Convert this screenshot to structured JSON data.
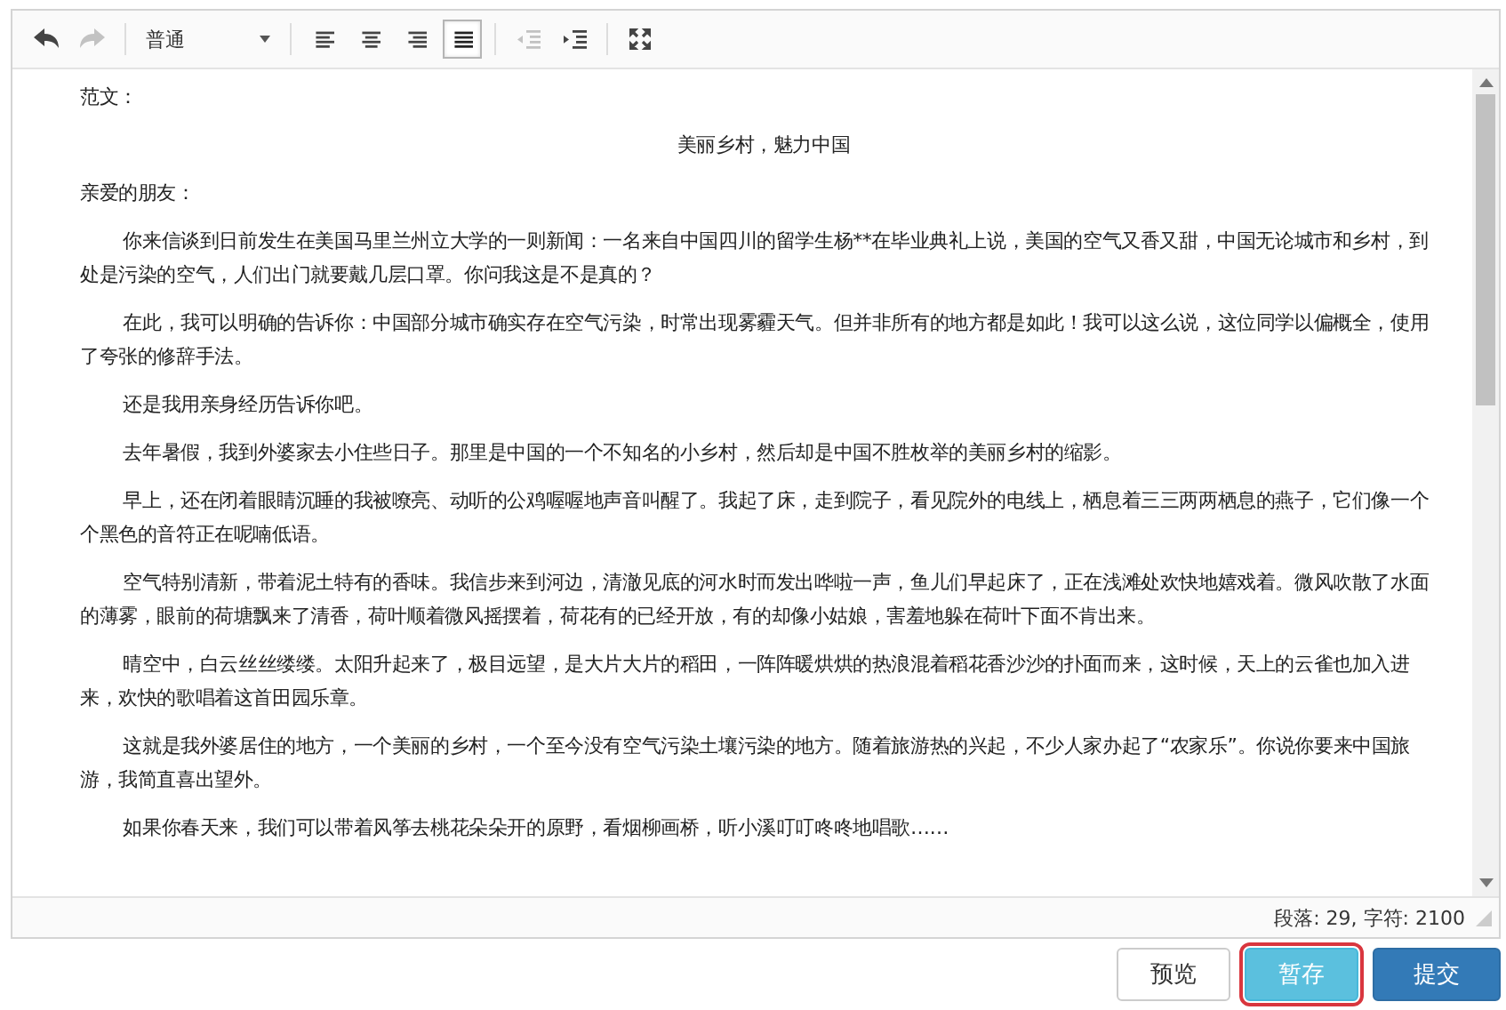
{
  "toolbar": {
    "groups": [
      {
        "tools": [
          {
            "kind": "undo",
            "disabled": false,
            "selected": false
          },
          {
            "kind": "redo",
            "disabled": true,
            "selected": false
          }
        ]
      },
      {
        "tools": [
          {
            "kind": "select",
            "value": "普通"
          }
        ]
      },
      {
        "tools": [
          {
            "kind": "align-left",
            "disabled": false,
            "selected": false
          },
          {
            "kind": "align-center",
            "disabled": false,
            "selected": false
          },
          {
            "kind": "align-right",
            "disabled": false,
            "selected": false
          },
          {
            "kind": "align-justify",
            "disabled": false,
            "selected": true
          }
        ]
      },
      {
        "tools": [
          {
            "kind": "outdent",
            "disabled": true,
            "selected": false
          },
          {
            "kind": "indent",
            "disabled": false,
            "selected": false
          }
        ]
      },
      {
        "tools": [
          {
            "kind": "fullscreen",
            "disabled": false,
            "selected": false
          }
        ]
      }
    ]
  },
  "content": {
    "paragraphs": [
      {
        "kind": "plain",
        "text": "范文："
      },
      {
        "kind": "center",
        "text": "美丽乡村，魅力中国"
      },
      {
        "kind": "plain",
        "text": "亲爱的朋友："
      },
      {
        "kind": "indent",
        "text": "你来信谈到日前发生在美国马里兰州立大学的一则新闻：一名来自中国四川的留学生杨**在毕业典礼上说，美国的空气又香又甜，中国无论城市和乡村，到处是污染的空气，人们出门就要戴几层口罩。你问我这是不是真的？"
      },
      {
        "kind": "indent",
        "text": "在此，我可以明确的告诉你：中国部分城市确实存在空气污染，时常出现雾霾天气。但并非所有的地方都是如此！我可以这么说，这位同学以偏概全，使用了夸张的修辞手法。"
      },
      {
        "kind": "indent",
        "text": "还是我用亲身经历告诉你吧。"
      },
      {
        "kind": "indent",
        "text": "去年暑假，我到外婆家去小住些日子。那里是中国的一个不知名的小乡村，然后却是中国不胜枚举的美丽乡村的缩影。"
      },
      {
        "kind": "indent",
        "text": "早上，还在闭着眼睛沉睡的我被嘹亮、动听的公鸡喔喔地声音叫醒了。我起了床，走到院子，看见院外的电线上，栖息着三三两两栖息的燕子，它们像一个个黑色的音符正在呢喃低语。"
      },
      {
        "kind": "indent",
        "text": "空气特别清新，带着泥土特有的香味。我信步来到河边，清澈见底的河水时而发出哗啦一声，鱼儿们早起床了，正在浅滩处欢快地嬉戏着。微风吹散了水面的薄雾，眼前的荷塘飘来了清香，荷叶顺着微风摇摆着，荷花有的已经开放，有的却像小姑娘，害羞地躲在荷叶下面不肯出来。"
      },
      {
        "kind": "indent",
        "text": "晴空中，白云丝丝缕缕。太阳升起来了，极目远望，是大片大片的稻田，一阵阵暖烘烘的热浪混着稻花香沙沙的扑面而来，这时候，天上的云雀也加入进来，欢快的歌唱着这首田园乐章。"
      },
      {
        "kind": "indent",
        "text": "这就是我外婆居住的地方，一个美丽的乡村，一个至今没有空气污染土壤污染的地方。随着旅游热的兴起，不少人家办起了“农家乐”。你说你要来中国旅游，我简直喜出望外。"
      },
      {
        "kind": "indent",
        "text": "如果你春天来，我们可以带着风筝去桃花朵朵开的原野，看烟柳画桥，听小溪叮叮咚咚地唱歌……"
      }
    ]
  },
  "status_bar": {
    "text": "段落: 29, 字符: 2100"
  },
  "buttons": [
    {
      "kind": "default",
      "label": "预览",
      "highlighted": false
    },
    {
      "kind": "info",
      "label": "暂存",
      "highlighted": true
    },
    {
      "kind": "primary",
      "label": "提交",
      "highlighted": false
    }
  ]
}
